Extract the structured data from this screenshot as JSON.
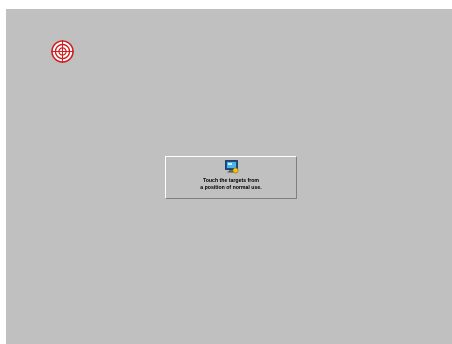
{
  "calibration": {
    "instruction_line1": "Touch the targets from",
    "instruction_line2": "a position of normal use."
  },
  "icons": {
    "target": "crosshair-target-icon",
    "panel": "monitor-touch-icon"
  },
  "colors": {
    "background": "#c0c0c0",
    "target": "#d11f1f",
    "panel_border_light": "#ffffff",
    "panel_border_dark": "#808080"
  }
}
